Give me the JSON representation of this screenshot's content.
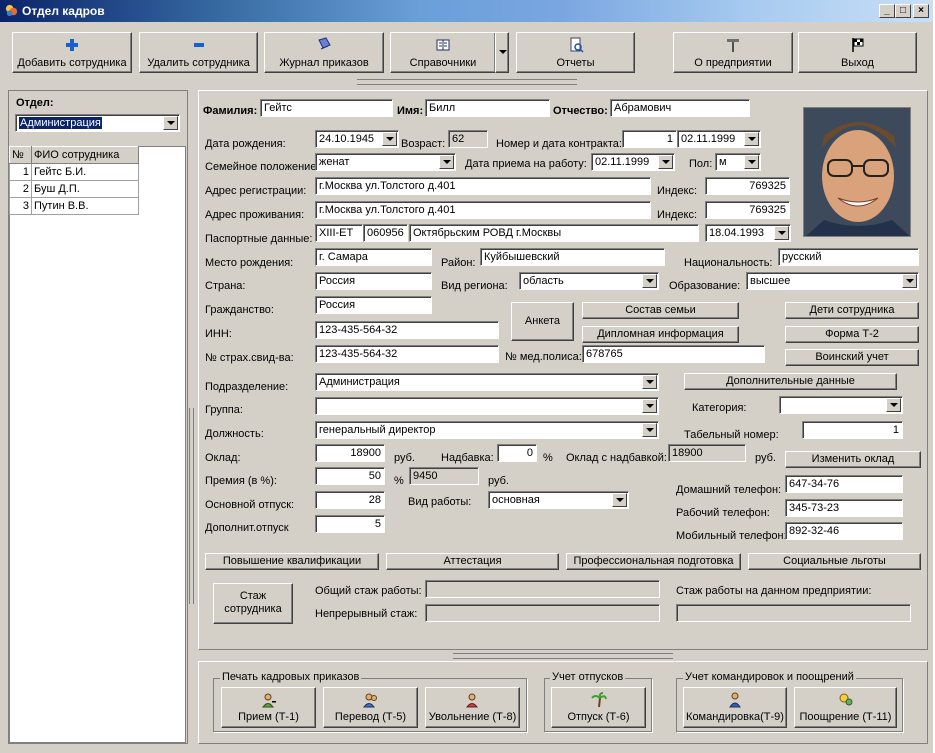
{
  "window": {
    "title": "Отдел кадров"
  },
  "toolbar": {
    "add_employee": "Добавить сотрудника",
    "delete_employee": "Удалить сотрудника",
    "orders_journal": "Журнал приказов",
    "references": "Справочники",
    "reports": "Отчеты",
    "about_company": "О предприятии",
    "exit": "Выход"
  },
  "left_panel": {
    "department_label": "Отдел:",
    "department_value": "Администрация",
    "table": {
      "headers": [
        "№",
        "ФИО сотрудника"
      ],
      "rows": [
        [
          "1",
          "Гейтс Б.И."
        ],
        [
          "2",
          "Буш Д.П."
        ],
        [
          "3",
          "Путин В.В."
        ]
      ]
    }
  },
  "form": {
    "surname_label": "Фамилия:",
    "surname": "Гейтс",
    "name_label": "Имя:",
    "name": "Билл",
    "patronymic_label": "Отчество:",
    "patronymic": "Абрамович",
    "birth_date_label": "Дата рождения:",
    "birth_date": "24.10.1945",
    "age_label": "Возраст:",
    "age": "62",
    "contract_label": "Номер и дата контракта:",
    "contract_number": "1",
    "contract_date": "02.11.1999",
    "family_label": "Семейное положение:",
    "family": "женат",
    "hire_date_label": "Дата приема на работу:",
    "hire_date": "02.11.1999",
    "sex_label": "Пол:",
    "sex": "м",
    "reg_address_label": "Адрес регистрации:",
    "reg_address": "г.Москва ул.Толстого д.401",
    "index_label": "Индекс:",
    "reg_index": "769325",
    "live_address_label": "Адрес проживания:",
    "live_address": "г.Москва ул.Толстого д.401",
    "live_index": "769325",
    "passport_label": "Паспортные данные:",
    "passport_series": "XIII-ЕТ",
    "passport_number": "060956",
    "passport_issued": "Октябрьским РОВД г.Москвы",
    "passport_date": "18.04.1993",
    "birthplace_label": "Место рождения:",
    "birthplace": "г. Самара",
    "district_label": "Район:",
    "district": "Куйбышевский",
    "nationality_label": "Национальность:",
    "nationality": "русский",
    "country_label": "Страна:",
    "country": "Россия",
    "region_type_label": "Вид региона:",
    "region_type": "область",
    "education_label": "Образование:",
    "education": "высшее",
    "citizenship_label": "Гражданство:",
    "citizenship": "Россия",
    "inn_label": "ИНН:",
    "inn": "123-435-564-32",
    "insurance_label": "№ страх.свид-ва:",
    "insurance": "123-435-564-32",
    "med_policy_label": "№ мед.полиса:",
    "med_policy": "678765",
    "subdivision_label": "Подразделение:",
    "subdivision": "Администрация",
    "group_label": "Группа:",
    "group": "",
    "position_label": "Должность:",
    "position": "генеральный директор",
    "category_label": "Категория:",
    "category": "",
    "tab_number_label": "Табельный номер:",
    "tab_number": "1",
    "salary_label": "Оклад:",
    "salary": "18900",
    "rub": "руб.",
    "bonus_label": "Надбавка:",
    "bonus": "0",
    "percent": "%",
    "salary_with_bonus_label": "Оклад с надбавкой:",
    "salary_with_bonus": "18900",
    "premium_label": "Премия (в %):",
    "premium": "50",
    "premium_sum": "9450",
    "main_vacation_label": "Основной отпуск:",
    "main_vacation": "28",
    "work_type_label": "Вид работы:",
    "work_type": "основная",
    "extra_vacation_label": "Дополнит.отпуск",
    "extra_vacation": "5",
    "home_phone_label": "Домашний телефон:",
    "home_phone": "647-34-76",
    "work_phone_label": "Рабочий телефон:",
    "work_phone": "345-73-23",
    "mobile_phone_label": "Мобильный телефон:",
    "mobile_phone": "892-32-46"
  },
  "buttons": {
    "anketa": "Анкета",
    "family_composition": "Состав семьи",
    "diploma_info": "Дипломная информация",
    "children": "Дети сотрудника",
    "form_t2": "Форма Т-2",
    "military": "Воинский учет",
    "additional_data": "Дополнительные данные",
    "change_salary": "Изменить оклад",
    "qualification": "Повышение квалификации",
    "attestation": "Аттестация",
    "prof_training": "Профессиональная подготовка",
    "social_benefits": "Социальные льготы",
    "experience": "Стаж сотрудника"
  },
  "experience": {
    "total_label": "Общий стаж работы:",
    "continuous_label": "Непрерывный стаж:",
    "company_label": "Стаж работы на данном предприятии:"
  },
  "bottom": {
    "print_orders_group": "Печать кадровых приказов",
    "hire": "Прием (Т-1)",
    "transfer": "Перевод (Т-5)",
    "dismissal": "Увольнение (Т-8)",
    "vacation_group": "Учет отпусков",
    "vacation": "Отпуск (Т-6)",
    "trips_group": "Учет командировок и поощрений",
    "business_trip": "Командировка(Т-9)",
    "reward": "Поощрение (Т-11)"
  },
  "colors": {
    "title_start": "#0a246a",
    "title_end": "#c9dff6",
    "face": "#d4d0c8",
    "selection": "#0a246a"
  },
  "icons": [
    "plus-icon",
    "minus-icon",
    "journal-icon",
    "book-icon",
    "report-icon",
    "company-icon",
    "flag-icon"
  ]
}
